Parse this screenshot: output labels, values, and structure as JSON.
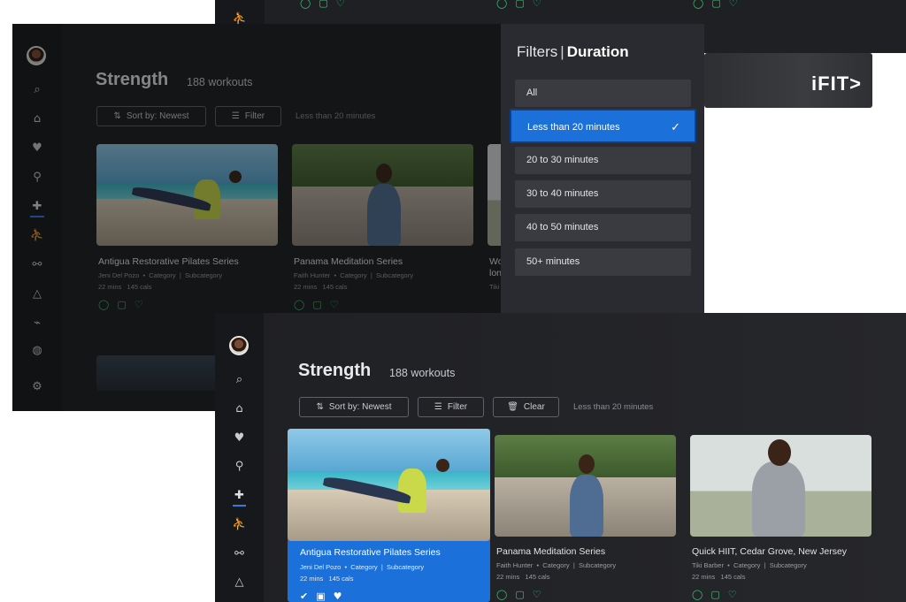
{
  "screen_top_back": {
    "card_icons": [
      "check-circle",
      "calendar",
      "heart"
    ]
  },
  "screen_left": {
    "title": "Strength",
    "count": "188 workouts",
    "sort_label": "Sort by: Newest",
    "filter_label": "Filter",
    "hint": "Less than 20 minutes",
    "cards": [
      {
        "title": "Antigua Restorative Pilates Series",
        "trainer": "Jeni Del Pozo",
        "category": "Category",
        "subcategory": "Subcategory",
        "mins": "22 mins",
        "cals": "145 cals"
      },
      {
        "title": "Panama Meditation Series",
        "trainer": "Faith Hunter",
        "category": "Category",
        "subcategory": "Subcategory",
        "mins": "22 mins",
        "cals": "145 cals"
      },
      {
        "title": "Wo",
        "title2": "lon",
        "trainer": "Tiki",
        "category": "",
        "subcategory": "",
        "mins": "",
        "cals": ""
      }
    ]
  },
  "filters_panel": {
    "label_prefix": "Filters",
    "label_sep": "|",
    "label_active": "Duration",
    "options": [
      "All",
      "Less than 20 minutes",
      "20 to 30 minutes",
      "30 to 40 minutes",
      "40 to 50 minutes",
      "50+ minutes"
    ],
    "selected_index": 1
  },
  "promo": {
    "logo": "iFIT>"
  },
  "screen_front": {
    "title": "Strength",
    "count": "188 workouts",
    "sort_label": "Sort by: Newest",
    "filter_label": "Filter",
    "clear_label": "Clear",
    "hint": "Less than 20 minutes",
    "cards": [
      {
        "title": "Antigua Restorative Pilates Series",
        "trainer": "Jeni Del Pozo",
        "category": "Category",
        "subcategory": "Subcategory",
        "mins": "22 mins",
        "cals": "145 cals"
      },
      {
        "title": "Panama Meditation Series",
        "trainer": "Faith Hunter",
        "category": "Category",
        "subcategory": "Subcategory",
        "mins": "22 mins",
        "cals": "145 cals"
      },
      {
        "title": "Quick HIIT, Cedar Grove, New Jersey",
        "trainer": "Tiki Barber",
        "category": "Category",
        "subcategory": "Subcategory",
        "mins": "22 mins",
        "cals": "145 cals"
      }
    ]
  },
  "colors": {
    "accent": "#1b70d9",
    "complete_icon": "#3fbf6f",
    "background": "#1c1d21"
  }
}
